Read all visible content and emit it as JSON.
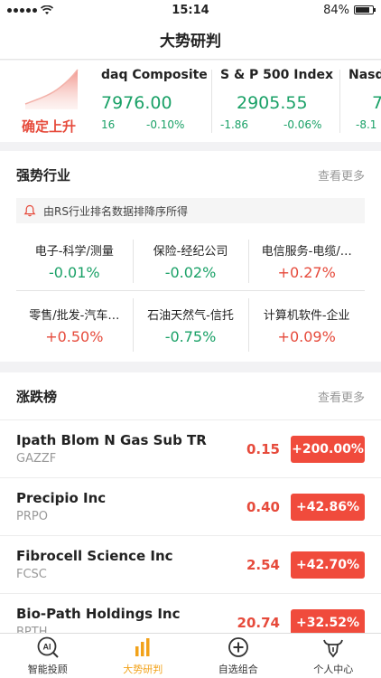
{
  "status_bar": {
    "time": "15:14",
    "battery": "84%",
    "battery_level": 0.84
  },
  "nav": {
    "title": "大势研判"
  },
  "market": {
    "trend_label": "确定上升",
    "indices": [
      {
        "name": "daq Composite",
        "value": "7976.00",
        "change": "16",
        "pct": "-0.10%"
      },
      {
        "name": "S & P 500 Index",
        "value": "2905.55",
        "change": "-1.86",
        "pct": "-0.06%"
      },
      {
        "name": "Nasd",
        "value": "7",
        "change": "-8.1",
        "pct": ""
      }
    ]
  },
  "strong_industry": {
    "title": "强势行业",
    "more": "查看更多",
    "notice": "由RS行业排名数据排降序所得",
    "items": [
      {
        "name": "电子-科学/测量",
        "change": "-0.01%",
        "dir": "down"
      },
      {
        "name": "保险-经纪公司",
        "change": "-0.02%",
        "dir": "down"
      },
      {
        "name": "电信服务-电缆/…",
        "change": "+0.27%",
        "dir": "up"
      },
      {
        "name": "零售/批发-汽车…",
        "change": "+0.50%",
        "dir": "up"
      },
      {
        "name": "石油天然气-信托",
        "change": "-0.75%",
        "dir": "down"
      },
      {
        "name": "计算机软件-企业",
        "change": "+0.09%",
        "dir": "up"
      }
    ]
  },
  "movers": {
    "title": "涨跌榜",
    "more": "查看更多",
    "rows": [
      {
        "name": "Ipath Blom N Gas Sub TR",
        "code": "GAZZF",
        "price": "0.15",
        "pct": "+200.00%"
      },
      {
        "name": "Precipio Inc",
        "code": "PRPO",
        "price": "0.40",
        "pct": "+42.86%"
      },
      {
        "name": "Fibrocell Science Inc",
        "code": "FCSC",
        "price": "2.54",
        "pct": "+42.70%"
      },
      {
        "name": "Bio-Path Holdings Inc",
        "code": "BPTH",
        "price": "20.74",
        "pct": "+32.52%"
      }
    ]
  },
  "tabs": [
    {
      "label": "智能投顾",
      "icon": "ai-icon"
    },
    {
      "label": "大势研判",
      "icon": "bar-chart-icon",
      "active": true
    },
    {
      "label": "自选组合",
      "icon": "plus-circle-icon"
    },
    {
      "label": "个人中心",
      "icon": "bull-icon"
    }
  ]
}
